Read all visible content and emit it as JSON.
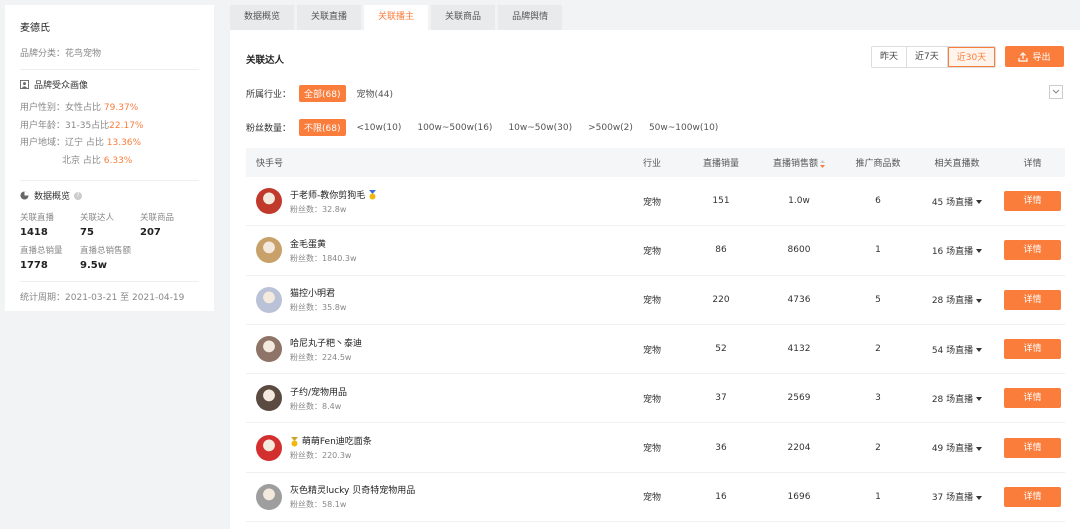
{
  "brand": {
    "name": "麦德氏",
    "category_label": "品牌分类：",
    "category_value": "花鸟宠物"
  },
  "audience": {
    "title": "品牌受众画像",
    "gender_label": "用户性别：",
    "gender_value": "女性占比",
    "gender_pct": "79.37%",
    "age_label": "用户年龄：",
    "age_value": "31-35占比",
    "age_pct": "22.17%",
    "region_label": "用户地域：",
    "region1": "辽宁 占比",
    "region1_pct": "13.36%",
    "region2": "北京 占比",
    "region2_pct": "6.33%"
  },
  "overview": {
    "title": "数据概览",
    "stats": [
      {
        "label": "关联直播",
        "value": "1418"
      },
      {
        "label": "关联达人",
        "value": "75"
      },
      {
        "label": "关联商品",
        "value": "207"
      },
      {
        "label": "直播总销量",
        "value": "1778"
      },
      {
        "label": "直播总销售额",
        "value": "9.5w"
      }
    ],
    "period_label": "统计周期：",
    "period_value": "2021-03-21 至 2021-04-19"
  },
  "tabs": [
    "数据概览",
    "关联直播",
    "关联播主",
    "关联商品",
    "品牌舆情"
  ],
  "active_tab": 2,
  "section_title": "关联达人",
  "date_buttons": [
    "昨天",
    "近7天",
    "近30天"
  ],
  "export_label": "导出",
  "industry_filter": {
    "label": "所属行业：",
    "chips": [
      "全部(68)",
      "宠物(44)"
    ]
  },
  "fans_filter": {
    "label": "粉丝数量：",
    "chips": [
      "不限(68)",
      "<10w(10)",
      "100w~500w(16)",
      "10w~50w(30)",
      ">500w(2)",
      "50w~100w(10)"
    ]
  },
  "table": {
    "headers": [
      "快手号",
      "行业",
      "直播销量",
      "直播销售额",
      "推广商品数",
      "相关直播数",
      "详情"
    ],
    "fans_prefix": "粉丝数：",
    "rows": [
      {
        "name": "于老师-教你剪狗毛",
        "fans": "32.8w",
        "industry": "宠物",
        "sales": "151",
        "amount": "1.0w",
        "goods": "6",
        "lives": "45 场直播",
        "detail": "详情",
        "avatar_color": "#c0392b"
      },
      {
        "name": "金毛蛋黄",
        "fans": "1840.3w",
        "industry": "宠物",
        "sales": "86",
        "amount": "8600",
        "goods": "1",
        "lives": "16 场直播",
        "detail": "详情",
        "avatar_color": "#c8a06a"
      },
      {
        "name": "猫控小明君",
        "fans": "35.8w",
        "industry": "宠物",
        "sales": "220",
        "amount": "4736",
        "goods": "5",
        "lives": "28 场直播",
        "detail": "详情",
        "avatar_color": "#b9c2d6"
      },
      {
        "name": "哈尼丸子粑丶泰迪",
        "fans": "224.5w",
        "industry": "宠物",
        "sales": "52",
        "amount": "4132",
        "goods": "2",
        "lives": "54 场直播",
        "detail": "详情",
        "avatar_color": "#8e7466"
      },
      {
        "name": "子约/宠物用品",
        "fans": "8.4w",
        "industry": "宠物",
        "sales": "37",
        "amount": "2569",
        "goods": "3",
        "lives": "28 场直播",
        "detail": "详情",
        "avatar_color": "#5a4a40"
      },
      {
        "name": "萌萌Fen迪吃面条",
        "fans": "220.3w",
        "industry": "宠物",
        "sales": "36",
        "amount": "2204",
        "goods": "2",
        "lives": "49 场直播",
        "detail": "详情",
        "avatar_color": "#d32f2f"
      },
      {
        "name": "灰色精灵lucky 贝奇特宠物用品",
        "fans": "58.1w",
        "industry": "宠物",
        "sales": "16",
        "amount": "1696",
        "goods": "1",
        "lives": "37 场直播",
        "detail": "详情",
        "avatar_color": "#9e9e9e"
      }
    ]
  }
}
